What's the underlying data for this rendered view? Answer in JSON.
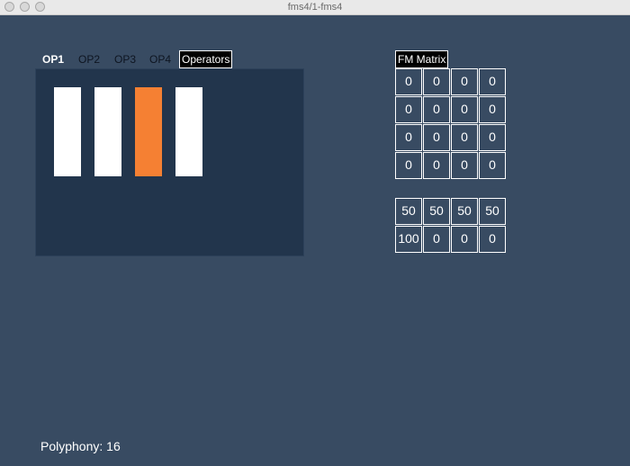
{
  "window": {
    "title": "fms4/1-fms4"
  },
  "tabs": [
    {
      "label": "OP1",
      "active": true
    },
    {
      "label": "OP2",
      "active": false
    },
    {
      "label": "OP3",
      "active": false
    },
    {
      "label": "OP4",
      "active": false
    }
  ],
  "operators_button": {
    "label": "Operators"
  },
  "operators": {
    "bars": [
      {
        "color": "#ffffff"
      },
      {
        "color": "#ffffff"
      },
      {
        "color": "#f58033"
      },
      {
        "color": "#ffffff"
      }
    ]
  },
  "fm_matrix": {
    "label": "FM Matrix",
    "rows": [
      [
        "0",
        "0",
        "0",
        "0"
      ],
      [
        "0",
        "0",
        "0",
        "0"
      ],
      [
        "0",
        "0",
        "0",
        "0"
      ],
      [
        "0",
        "0",
        "0",
        "0"
      ]
    ],
    "levels": [
      "50",
      "50",
      "50",
      "50"
    ],
    "output": [
      "100",
      "0",
      "0",
      "0"
    ]
  },
  "status": {
    "polyphony": "Polyphony: 16"
  },
  "colors": {
    "background": "#384b62",
    "panel": "#22354c",
    "accent": "#f58033"
  }
}
